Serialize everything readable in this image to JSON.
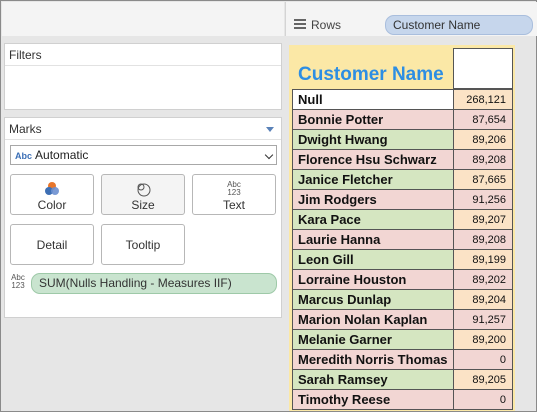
{
  "colors": {
    "header_text": "#2d8ee3",
    "row_pill": "#c6d6ec",
    "measure_pill": "#c9e4cf",
    "view_background": "#fbe8a6",
    "row_fill_pink": "#f2d6d3",
    "row_fill_green": "#d5e6c1",
    "value_fill_peach": "#fbe3c6"
  },
  "shelves": {
    "rows_label": "Rows",
    "rows_pill": "Customer Name"
  },
  "filters": {
    "title": "Filters"
  },
  "marks": {
    "title": "Marks",
    "mark_type_icon": "Abc",
    "mark_type": "Automatic",
    "buttons": {
      "color": "Color",
      "size": "Size",
      "text": "Text",
      "text_icon_top": "Abc",
      "text_icon_bottom": "123",
      "detail": "Detail",
      "tooltip": "Tooltip"
    },
    "measure_type_top": "Abc",
    "measure_type_bottom": "123",
    "measure_pill": "SUM(Nulls Handling - Measures IIF)"
  },
  "table": {
    "header": "Customer Name",
    "rows": [
      {
        "name": "Null",
        "value": "268,121",
        "fill": "white"
      },
      {
        "name": "Bonnie Potter",
        "value": "87,654",
        "fill": "pink"
      },
      {
        "name": "Dwight Hwang",
        "value": "89,206",
        "fill": "green"
      },
      {
        "name": "Florence Hsu Schwarz",
        "value": "89,208",
        "fill": "pink"
      },
      {
        "name": "Janice Fletcher",
        "value": "87,665",
        "fill": "green"
      },
      {
        "name": "Jim Rodgers",
        "value": "91,256",
        "fill": "pink"
      },
      {
        "name": "Kara Pace",
        "value": "89,207",
        "fill": "green"
      },
      {
        "name": "Laurie Hanna",
        "value": "89,208",
        "fill": "pink"
      },
      {
        "name": "Leon Gill",
        "value": "89,199",
        "fill": "green"
      },
      {
        "name": "Lorraine Houston",
        "value": "89,202",
        "fill": "pink"
      },
      {
        "name": "Marcus Dunlap",
        "value": "89,204",
        "fill": "green"
      },
      {
        "name": "Marion Nolan Kaplan",
        "value": "91,257",
        "fill": "pink"
      },
      {
        "name": "Melanie Garner",
        "value": "89,200",
        "fill": "green"
      },
      {
        "name": "Meredith Norris Thomas",
        "value": "0",
        "fill": "pink"
      },
      {
        "name": "Sarah Ramsey",
        "value": "89,205",
        "fill": "green"
      },
      {
        "name": "Timothy Reese",
        "value": "0",
        "fill": "pink"
      }
    ]
  }
}
